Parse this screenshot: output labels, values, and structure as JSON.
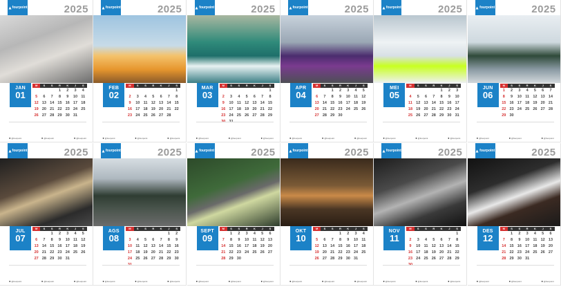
{
  "year": "2025",
  "brand": "fourpoint",
  "weekdays": [
    "M",
    "S",
    "S",
    "R",
    "K",
    "J",
    "S"
  ],
  "social": [
    "@fourpoint",
    "@fourpoint",
    "@fourpoint"
  ],
  "months": [
    {
      "name": "JAN",
      "num": "01",
      "photo": "basketball-hoop-photo",
      "weeks": [
        [
          "",
          "",
          "",
          "1",
          "2",
          "3",
          "4"
        ],
        [
          "5",
          "6",
          "7",
          "8",
          "9",
          "10",
          "11"
        ],
        [
          "12",
          "13",
          "14",
          "15",
          "16",
          "17",
          "18"
        ],
        [
          "19",
          "20",
          "21",
          "22",
          "23",
          "24",
          "25"
        ],
        [
          "26",
          "27",
          "28",
          "29",
          "30",
          "31",
          ""
        ]
      ]
    },
    {
      "name": "FEB",
      "num": "02",
      "photo": "kayak-photo",
      "weeks": [
        [
          "",
          "",
          "",
          "",
          "",
          "",
          "1"
        ],
        [
          "2",
          "3",
          "4",
          "5",
          "6",
          "7",
          "8"
        ],
        [
          "9",
          "10",
          "11",
          "12",
          "13",
          "14",
          "15"
        ],
        [
          "16",
          "17",
          "18",
          "19",
          "20",
          "21",
          "22"
        ],
        [
          "23",
          "24",
          "25",
          "26",
          "27",
          "28",
          ""
        ]
      ]
    },
    {
      "name": "MAR",
      "num": "03",
      "photo": "ocean-wave-photo",
      "weeks": [
        [
          "",
          "",
          "",
          "",
          "",
          "",
          "1"
        ],
        [
          "2",
          "3",
          "4",
          "5",
          "6",
          "7",
          "8"
        ],
        [
          "9",
          "10",
          "11",
          "12",
          "13",
          "14",
          "15"
        ],
        [
          "16",
          "17",
          "18",
          "19",
          "20",
          "21",
          "22"
        ],
        [
          "23",
          "24",
          "25",
          "26",
          "27",
          "28",
          "29"
        ],
        [
          "30",
          "31",
          "",
          "",
          "",
          "",
          ""
        ]
      ]
    },
    {
      "name": "APR",
      "num": "04",
      "photo": "race-car-photo",
      "weeks": [
        [
          "",
          "",
          "1",
          "2",
          "3",
          "4",
          "5"
        ],
        [
          "6",
          "7",
          "8",
          "9",
          "10",
          "11",
          "12"
        ],
        [
          "13",
          "14",
          "15",
          "16",
          "17",
          "18",
          "19"
        ],
        [
          "20",
          "21",
          "22",
          "23",
          "24",
          "25",
          "26"
        ],
        [
          "27",
          "28",
          "29",
          "30",
          "",
          "",
          ""
        ]
      ]
    },
    {
      "name": "MEI",
      "num": "05",
      "photo": "snow-skiing-photo",
      "weeks": [
        [
          "",
          "",
          "",
          "",
          "1",
          "2",
          "3"
        ],
        [
          "4",
          "5",
          "6",
          "7",
          "8",
          "9",
          "10"
        ],
        [
          "11",
          "12",
          "13",
          "14",
          "15",
          "16",
          "17"
        ],
        [
          "18",
          "19",
          "20",
          "21",
          "22",
          "23",
          "24"
        ],
        [
          "25",
          "26",
          "27",
          "28",
          "29",
          "30",
          "31"
        ]
      ]
    },
    {
      "name": "JUN",
      "num": "06",
      "photo": "skateboard-palms-photo",
      "weeks": [
        [
          "1",
          "2",
          "3",
          "4",
          "5",
          "6",
          "7"
        ],
        [
          "8",
          "9",
          "10",
          "11",
          "12",
          "13",
          "14"
        ],
        [
          "15",
          "16",
          "17",
          "18",
          "19",
          "20",
          "21"
        ],
        [
          "22",
          "23",
          "24",
          "25",
          "26",
          "27",
          "28"
        ],
        [
          "29",
          "30",
          "",
          "",
          "",
          "",
          ""
        ]
      ]
    },
    {
      "name": "JUL",
      "num": "07",
      "photo": "hiking-boots-photo",
      "weeks": [
        [
          "",
          "",
          "1",
          "2",
          "3",
          "4",
          "5"
        ],
        [
          "6",
          "7",
          "8",
          "9",
          "10",
          "11",
          "12"
        ],
        [
          "13",
          "14",
          "15",
          "16",
          "17",
          "18",
          "19"
        ],
        [
          "20",
          "21",
          "22",
          "23",
          "24",
          "25",
          "26"
        ],
        [
          "27",
          "28",
          "29",
          "30",
          "31",
          "",
          ""
        ]
      ]
    },
    {
      "name": "AGS",
      "num": "08",
      "photo": "road-cycling-photo",
      "weeks": [
        [
          "",
          "",
          "",
          "",
          "",
          "1",
          "2"
        ],
        [
          "3",
          "4",
          "5",
          "6",
          "7",
          "8",
          "9"
        ],
        [
          "10",
          "11",
          "12",
          "13",
          "14",
          "15",
          "16"
        ],
        [
          "17",
          "18",
          "19",
          "20",
          "21",
          "22",
          "23"
        ],
        [
          "24",
          "25",
          "26",
          "27",
          "28",
          "29",
          "30"
        ],
        [
          "31",
          "",
          "",
          "",
          "",
          "",
          ""
        ]
      ]
    },
    {
      "name": "SEPT",
      "num": "09",
      "photo": "mountain-bike-photo",
      "weeks": [
        [
          "",
          "1",
          "2",
          "3",
          "4",
          "5",
          "6"
        ],
        [
          "7",
          "8",
          "9",
          "10",
          "11",
          "12",
          "13"
        ],
        [
          "14",
          "15",
          "16",
          "17",
          "18",
          "19",
          "20"
        ],
        [
          "21",
          "22",
          "23",
          "24",
          "25",
          "26",
          "27"
        ],
        [
          "28",
          "29",
          "30",
          "",
          "",
          "",
          ""
        ]
      ]
    },
    {
      "name": "OKT",
      "num": "10",
      "photo": "gym-interior-photo",
      "weeks": [
        [
          "",
          "",
          "",
          "1",
          "2",
          "3",
          "4"
        ],
        [
          "5",
          "6",
          "7",
          "8",
          "9",
          "10",
          "11"
        ],
        [
          "12",
          "13",
          "14",
          "15",
          "16",
          "17",
          "18"
        ],
        [
          "19",
          "20",
          "21",
          "22",
          "23",
          "24",
          "25"
        ],
        [
          "26",
          "27",
          "28",
          "29",
          "30",
          "31",
          ""
        ]
      ]
    },
    {
      "name": "NOV",
      "num": "11",
      "photo": "weight-training-photo",
      "weeks": [
        [
          "",
          "",
          "",
          "",
          "",
          "",
          "1"
        ],
        [
          "2",
          "3",
          "4",
          "5",
          "6",
          "7",
          "8"
        ],
        [
          "9",
          "10",
          "11",
          "12",
          "13",
          "14",
          "15"
        ],
        [
          "16",
          "17",
          "18",
          "19",
          "20",
          "21",
          "22"
        ],
        [
          "23",
          "24",
          "25",
          "26",
          "27",
          "28",
          "29"
        ],
        [
          "30",
          "",
          "",
          "",
          "",
          "",
          ""
        ]
      ]
    },
    {
      "name": "DES",
      "num": "12",
      "photo": "gym-athlete-photo",
      "weeks": [
        [
          "",
          "1",
          "2",
          "3",
          "4",
          "5",
          "6"
        ],
        [
          "7",
          "8",
          "9",
          "10",
          "11",
          "12",
          "13"
        ],
        [
          "14",
          "15",
          "16",
          "17",
          "18",
          "19",
          "20"
        ],
        [
          "21",
          "22",
          "23",
          "24",
          "25",
          "26",
          "27"
        ],
        [
          "28",
          "29",
          "30",
          "31",
          "",
          "",
          ""
        ]
      ]
    }
  ]
}
